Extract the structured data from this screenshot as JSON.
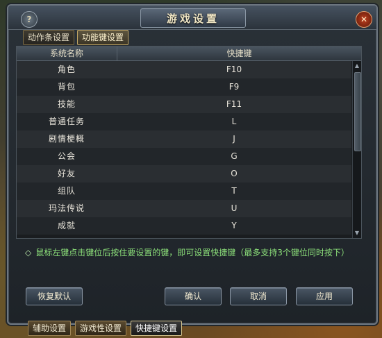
{
  "window": {
    "title": "游戏设置",
    "help_label": "?",
    "close_label": "✕"
  },
  "tabs": [
    {
      "label": "动作条设置",
      "active": false
    },
    {
      "label": "功能键设置",
      "active": true
    }
  ],
  "table": {
    "headers": {
      "name": "系统名称",
      "key": "快捷键"
    },
    "rows": [
      {
        "name": "角色",
        "key": "F10"
      },
      {
        "name": "背包",
        "key": "F9"
      },
      {
        "name": "技能",
        "key": "F11"
      },
      {
        "name": "普通任务",
        "key": "L"
      },
      {
        "name": "剧情梗概",
        "key": "J"
      },
      {
        "name": "公会",
        "key": "G"
      },
      {
        "name": "好友",
        "key": "O"
      },
      {
        "name": "组队",
        "key": "T"
      },
      {
        "name": "玛法传说",
        "key": "U"
      },
      {
        "name": "成就",
        "key": "Y"
      }
    ]
  },
  "hint": {
    "bullet": "◇",
    "text": "鼠标左键点击键位后按住要设置的键，即可设置快捷键（最多支持3个键位同时按下）"
  },
  "buttons": {
    "restore": "恢复默认",
    "confirm": "确认",
    "cancel": "取消",
    "apply": "应用"
  },
  "bottom_tabs": [
    {
      "label": "辅助设置",
      "active": false
    },
    {
      "label": "游戏性设置",
      "active": false
    },
    {
      "label": "快捷键设置",
      "active": true
    }
  ],
  "colors": {
    "hint": "#8ce07a",
    "title": "#f0e6c4"
  },
  "icons": {
    "help": "question-icon",
    "close": "close-icon"
  }
}
